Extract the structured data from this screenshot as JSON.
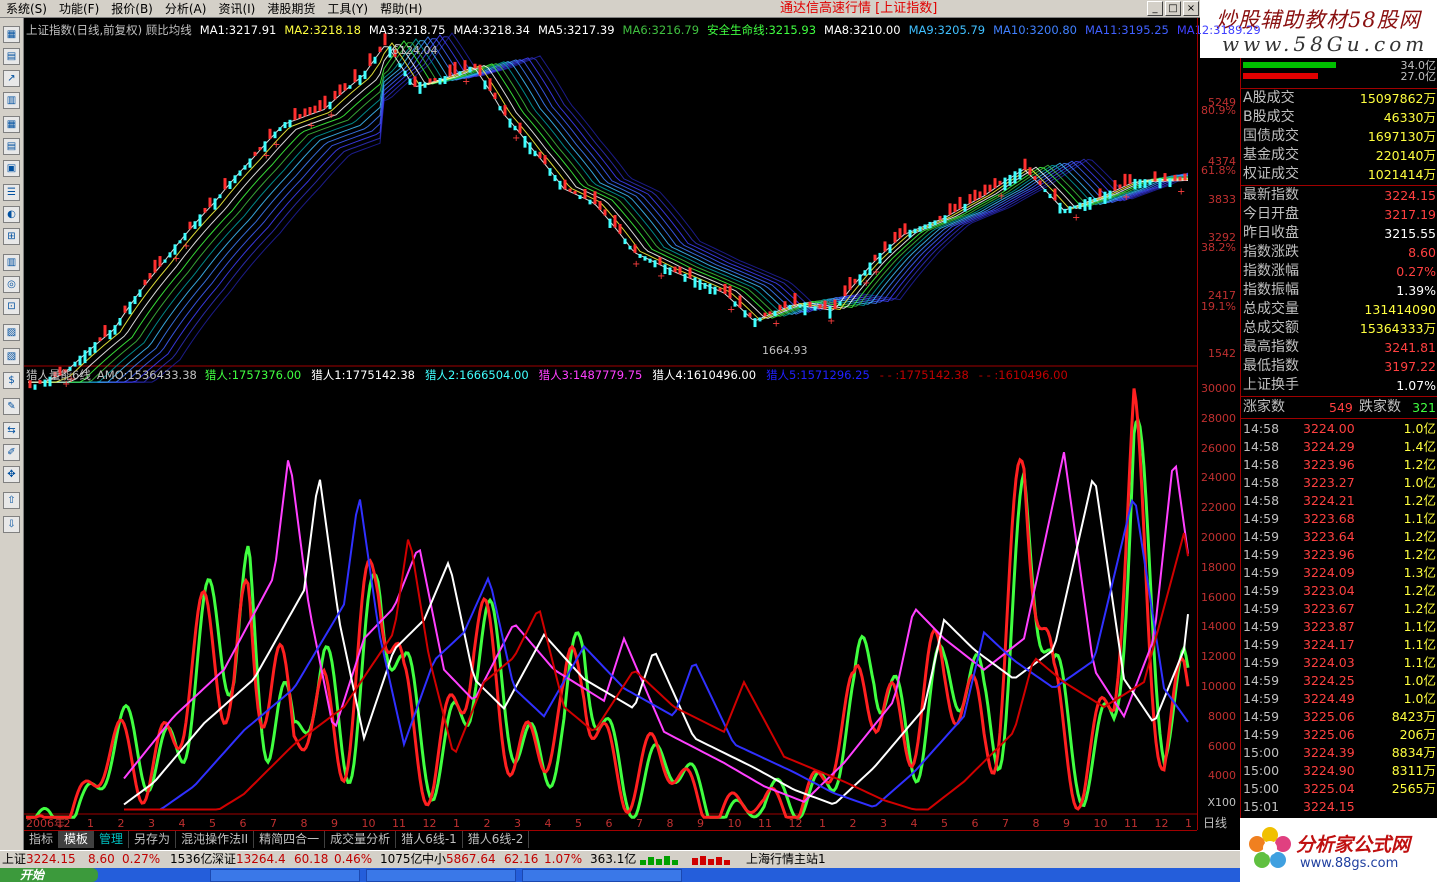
{
  "menu": {
    "items": [
      "系统(S)",
      "功能(F)",
      "报价(B)",
      "分析(A)",
      "资讯(I)",
      "港股期货",
      "工具(Y)",
      "帮助(H)"
    ],
    "app_title": "通达信高速行情 [上证指数]"
  },
  "watermark": {
    "line1": "炒股辅助教材58股网",
    "line2": "www.58Gu.com"
  },
  "chart_top": {
    "header_label": "上证指数(日线,前复权) 顾比均线",
    "ma": [
      {
        "name": "MA1",
        "value": "3217.91",
        "color": "#ffffff"
      },
      {
        "name": "MA2",
        "value": "3218.18",
        "color": "#ffff40"
      },
      {
        "name": "MA3",
        "value": "3218.75",
        "color": "#ffffff"
      },
      {
        "name": "MA4",
        "value": "3218.34",
        "color": "#ffffff"
      },
      {
        "name": "MA5",
        "value": "3217.39",
        "color": "#ffffff"
      },
      {
        "name": "MA6",
        "value": "3216.79",
        "color": "#40c040"
      },
      {
        "name": "安全生命线",
        "value": "3215.93",
        "color": "#40ff40"
      },
      {
        "name": "MA8",
        "value": "3210.00",
        "color": "#ffffff"
      },
      {
        "name": "MA9",
        "value": "3205.79",
        "color": "#40c0ff"
      },
      {
        "name": "MA10",
        "value": "3200.80",
        "color": "#4080ff"
      },
      {
        "name": "MA11",
        "value": "3195.25",
        "color": "#4060ff"
      },
      {
        "name": "MA12",
        "value": "3189.29",
        "color": "#4040ff"
      }
    ],
    "high_label": "6124.04",
    "low_label": "1664.93",
    "yticks": [
      "5249",
      "80.9%",
      "4374",
      "61.8%",
      "3833",
      "3292",
      "38.2%",
      "2417",
      "19.1%",
      "1542"
    ]
  },
  "chart_bottom": {
    "header_label": "猎人量能6线",
    "amo_label": "AMO:1536433.38",
    "items": [
      {
        "label": "猎人:1757376.00",
        "color": "#40ff40"
      },
      {
        "label": "猎人1:1775142.38",
        "color": "#ffffff"
      },
      {
        "label": "猎人2:1666504.00",
        "color": "#40ffff"
      },
      {
        "label": "猎人3:1487779.75",
        "color": "#ff40ff"
      },
      {
        "label": "猎人4:1610496.00",
        "color": "#ffffff"
      },
      {
        "label": "猎人5:1571296.25",
        "color": "#2020ff"
      },
      {
        "label": "- - :1775142.38",
        "color": "#c00000"
      },
      {
        "label": "- - :1610496.00",
        "color": "#c00000"
      }
    ],
    "yticks": [
      "30000",
      "28000",
      "26000",
      "24000",
      "22000",
      "20000",
      "18000",
      "16000",
      "14000",
      "12000",
      "10000",
      "8000",
      "6000",
      "4000"
    ],
    "unit_label": "X100"
  },
  "xaxis": {
    "labels": [
      "2006年",
      "12",
      "1",
      "2",
      "3",
      "4",
      "5",
      "6",
      "7",
      "8",
      "9",
      "10",
      "11",
      "12",
      "1",
      "2",
      "3",
      "4",
      "5",
      "6",
      "7",
      "8",
      "9",
      "10",
      "11",
      "12",
      "1",
      "2",
      "3",
      "4",
      "5",
      "6",
      "7",
      "8",
      "9",
      "10",
      "11",
      "12",
      "1"
    ],
    "period": "日线"
  },
  "bottom_tabs": [
    "指标",
    "模板",
    "管理",
    "另存为",
    "混沌操作法II",
    "精简四合一",
    "成交量分析",
    "猎人6线-1",
    "猎人6线-2"
  ],
  "panel": {
    "bars": [
      {
        "label": "34.0亿",
        "fill": 0.62,
        "color": "#00c000"
      },
      {
        "label": "27.0亿",
        "fill": 0.5,
        "color": "#e00000"
      }
    ],
    "volume_rows": [
      {
        "label": "A股成交",
        "value": "15097862万",
        "color": "#ffff40"
      },
      {
        "label": "B股成交",
        "value": "46330万",
        "color": "#ffff40"
      },
      {
        "label": "国债成交",
        "value": "1697130万",
        "color": "#ffff40"
      },
      {
        "label": "基金成交",
        "value": "220140万",
        "color": "#ffff40"
      },
      {
        "label": "权证成交",
        "value": "1021414万",
        "color": "#ffff40"
      }
    ],
    "index_rows": [
      {
        "label": "最新指数",
        "value": "3224.15",
        "color": "#ff4040"
      },
      {
        "label": "今日开盘",
        "value": "3217.19",
        "color": "#ff4040"
      },
      {
        "label": "昨日收盘",
        "value": "3215.55",
        "color": "#ffffff"
      },
      {
        "label": "指数涨跌",
        "value": "8.60",
        "color": "#ff4040"
      },
      {
        "label": "指数涨幅",
        "value": "0.27%",
        "color": "#ff4040"
      },
      {
        "label": "指数振幅",
        "value": "1.39%",
        "color": "#ffffff"
      },
      {
        "label": "总成交量",
        "value": "131414090",
        "color": "#ffff40"
      },
      {
        "label": "总成交额",
        "value": "15364333万",
        "color": "#ffff40"
      },
      {
        "label": "最高指数",
        "value": "3241.81",
        "color": "#ff4040"
      },
      {
        "label": "最低指数",
        "value": "3197.22",
        "color": "#ff4040"
      },
      {
        "label": "上证换手",
        "value": "1.07%",
        "color": "#ffffff"
      }
    ],
    "updown": {
      "up_label": "涨家数",
      "up": "549",
      "down_label": "跌家数",
      "down": "321"
    },
    "ticks": [
      {
        "t": "14:58",
        "p": "3224.00",
        "v": "1.0亿"
      },
      {
        "t": "14:58",
        "p": "3224.29",
        "v": "1.4亿"
      },
      {
        "t": "14:58",
        "p": "3223.96",
        "v": "1.2亿"
      },
      {
        "t": "14:58",
        "p": "3223.27",
        "v": "1.0亿"
      },
      {
        "t": "14:58",
        "p": "3224.21",
        "v": "1.2亿"
      },
      {
        "t": "14:59",
        "p": "3223.68",
        "v": "1.1亿"
      },
      {
        "t": "14:59",
        "p": "3223.64",
        "v": "1.2亿"
      },
      {
        "t": "14:59",
        "p": "3223.96",
        "v": "1.2亿"
      },
      {
        "t": "14:59",
        "p": "3224.09",
        "v": "1.3亿"
      },
      {
        "t": "14:59",
        "p": "3223.04",
        "v": "1.2亿"
      },
      {
        "t": "14:59",
        "p": "3223.67",
        "v": "1.2亿"
      },
      {
        "t": "14:59",
        "p": "3223.87",
        "v": "1.1亿"
      },
      {
        "t": "14:59",
        "p": "3224.17",
        "v": "1.1亿"
      },
      {
        "t": "14:59",
        "p": "3224.03",
        "v": "1.1亿"
      },
      {
        "t": "14:59",
        "p": "3224.25",
        "v": "1.0亿"
      },
      {
        "t": "14:59",
        "p": "3224.49",
        "v": "1.0亿"
      },
      {
        "t": "14:59",
        "p": "3225.06",
        "v": "8423万"
      },
      {
        "t": "14:59",
        "p": "3225.06",
        "v": "206万"
      },
      {
        "t": "15:00",
        "p": "3224.39",
        "v": "8834万"
      },
      {
        "t": "15:00",
        "p": "3224.90",
        "v": "8311万"
      },
      {
        "t": "15:00",
        "p": "3225.04",
        "v": "2565万"
      },
      {
        "t": "15:01",
        "p": "3224.15",
        "v": ""
      }
    ]
  },
  "statusbar": {
    "sh_label": "上证",
    "sh_value": "3224.15",
    "sh_chg": "8.60",
    "sh_pct": "0.27%",
    "sh_amt": "1536亿",
    "sz_label": "深证",
    "sz_value": "13264.4",
    "sz_chg": "60.18",
    "sz_pct": "0.46%",
    "sz_amt": "1075亿",
    "zx_label": "中小",
    "zx_value": "5867.64",
    "zx_chg": "62.16",
    "zx_pct": "1.07%",
    "zx_amt": "363.1亿",
    "server": "上海行情主站1"
  },
  "taskbar": {
    "start": "开始",
    "tasks": [
      "",
      "",
      "",
      "",
      ""
    ]
  },
  "logo2": {
    "line1": "分析家公式网",
    "line2": "www.88gs.com"
  }
}
